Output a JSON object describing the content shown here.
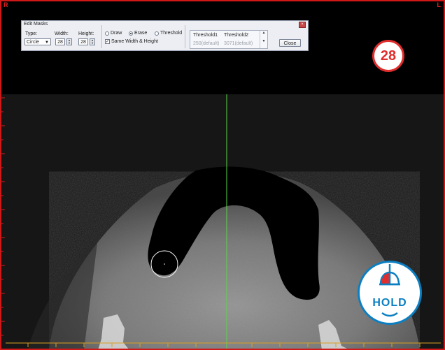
{
  "viewport": {
    "orientation_right": "R",
    "orientation_left": "L"
  },
  "edit_masks": {
    "title": "Edit Masks",
    "type_label": "Type:",
    "type_value": "Circle",
    "width_label": "Width:",
    "width_value": "28",
    "height_label": "Height:",
    "height_value": "28",
    "mode_options": [
      "Draw",
      "Erase",
      "Threshold"
    ],
    "mode_selected": "Erase",
    "same_size_label": "Same Width & Height",
    "same_size_checked": true,
    "threshold1_label": "Threshold1",
    "threshold2_label": "Threshold2",
    "threshold1_value": "250(default)",
    "threshold2_value": "3071(default)",
    "close_label": "Close"
  },
  "step_badge": {
    "number": "28",
    "color": "#e02d2d"
  },
  "hold_badge": {
    "label": "HOLD",
    "color": "#0c7fc2",
    "icon": "mouse-left-click-icon"
  },
  "colors": {
    "frame": "#d01818",
    "crosshair_vertical": "#58d84a",
    "crosshair_horizontal": "#d8a020"
  }
}
